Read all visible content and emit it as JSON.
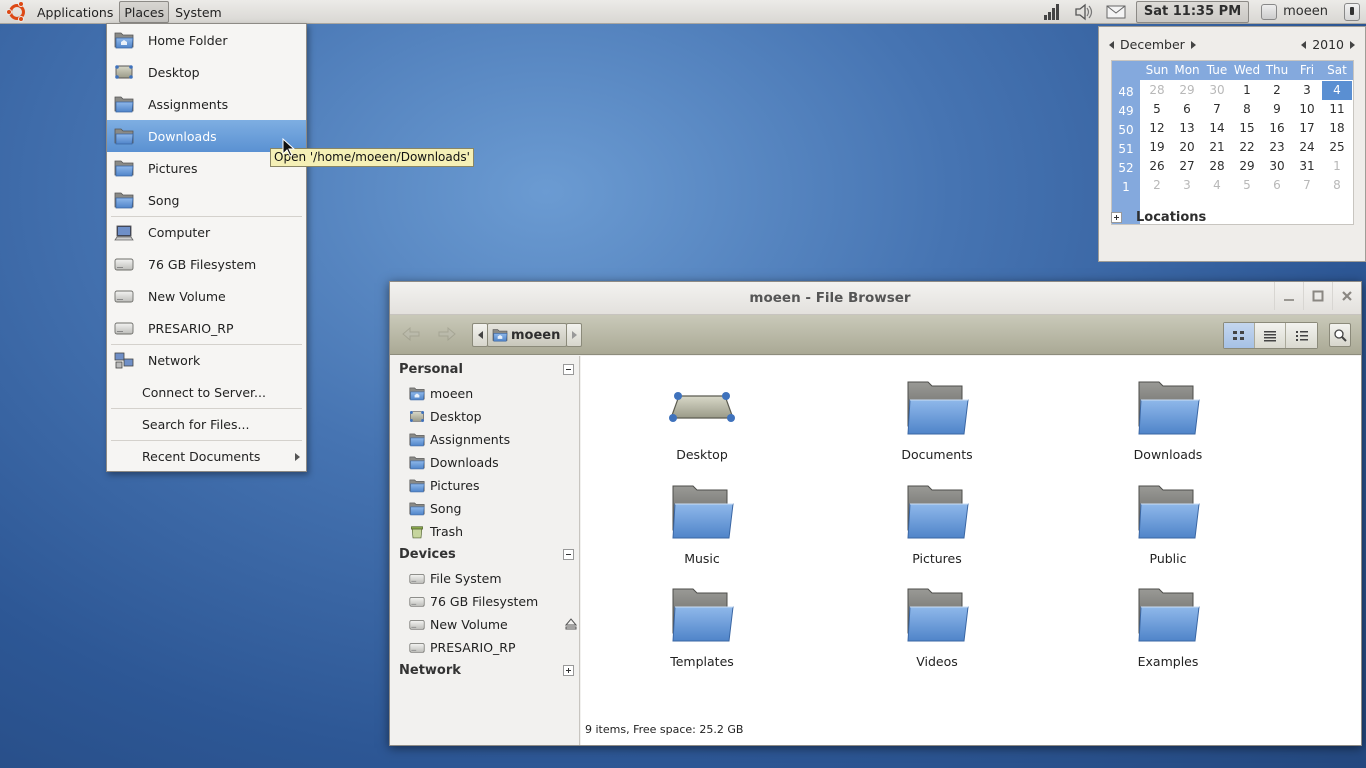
{
  "panel": {
    "menus": [
      "Applications",
      "Places",
      "System"
    ],
    "clock": "Sat 11:35 PM",
    "user": "moeen"
  },
  "places_menu": {
    "items": [
      {
        "label": "Home Folder",
        "icon": "home-folder-icon"
      },
      {
        "label": "Desktop",
        "icon": "desktop-icon"
      },
      {
        "label": "Assignments",
        "icon": "folder-icon"
      },
      {
        "label": "Downloads",
        "icon": "folder-icon",
        "highlighted": true
      },
      {
        "label": "Pictures",
        "icon": "folder-icon"
      },
      {
        "label": "Song",
        "icon": "folder-icon"
      },
      {
        "label": "Computer",
        "icon": "computer-icon"
      },
      {
        "label": "76 GB Filesystem",
        "icon": "drive-icon"
      },
      {
        "label": "New Volume",
        "icon": "drive-icon"
      },
      {
        "label": "PRESARIO_RP",
        "icon": "drive-icon"
      },
      {
        "label": "Network",
        "icon": "network-icon"
      },
      {
        "label": "Connect to Server..."
      },
      {
        "label": "Search for Files..."
      },
      {
        "label": "Recent Documents"
      }
    ]
  },
  "tooltip": "Open '/home/moeen/Downloads'",
  "calendar": {
    "month": "December",
    "year": "2010",
    "weekdays": [
      "Sun",
      "Mon",
      "Tue",
      "Wed",
      "Thu",
      "Fri",
      "Sat"
    ],
    "weeks": [
      "48",
      "49",
      "50",
      "51",
      "52",
      "1"
    ],
    "days": [
      [
        "28",
        "29",
        "30",
        "1",
        "2",
        "3",
        "4"
      ],
      [
        "5",
        "6",
        "7",
        "8",
        "9",
        "10",
        "11"
      ],
      [
        "12",
        "13",
        "14",
        "15",
        "16",
        "17",
        "18"
      ],
      [
        "19",
        "20",
        "21",
        "22",
        "23",
        "24",
        "25"
      ],
      [
        "26",
        "27",
        "28",
        "29",
        "30",
        "31",
        "1"
      ],
      [
        "2",
        "3",
        "4",
        "5",
        "6",
        "7",
        "8"
      ]
    ],
    "selected_day": "4",
    "locations_label": "Locations"
  },
  "file_browser": {
    "title": "moeen - File Browser",
    "path_crumb": "moeen",
    "sidebar": {
      "personal_label": "Personal",
      "personal_items": [
        {
          "label": "moeen",
          "icon": "home-folder-icon"
        },
        {
          "label": "Desktop",
          "icon": "desktop-icon"
        },
        {
          "label": "Assignments",
          "icon": "folder-icon"
        },
        {
          "label": "Downloads",
          "icon": "folder-icon"
        },
        {
          "label": "Pictures",
          "icon": "folder-icon"
        },
        {
          "label": "Song",
          "icon": "folder-icon"
        },
        {
          "label": "Trash",
          "icon": "trash-icon"
        }
      ],
      "devices_label": "Devices",
      "device_items": [
        {
          "label": "File System",
          "icon": "drive-icon"
        },
        {
          "label": "76 GB Filesystem",
          "icon": "drive-icon"
        },
        {
          "label": "New Volume",
          "icon": "drive-icon",
          "eject": true
        },
        {
          "label": "PRESARIO_RP",
          "icon": "drive-icon"
        }
      ],
      "network_label": "Network"
    },
    "items": [
      {
        "label": "Desktop",
        "icon": "desktop-icon"
      },
      {
        "label": "Documents",
        "icon": "folder-icon"
      },
      {
        "label": "Downloads",
        "icon": "folder-icon"
      },
      {
        "label": "Music",
        "icon": "folder-icon"
      },
      {
        "label": "Pictures",
        "icon": "folder-icon"
      },
      {
        "label": "Public",
        "icon": "folder-icon"
      },
      {
        "label": "Templates",
        "icon": "folder-icon"
      },
      {
        "label": "Videos",
        "icon": "folder-icon"
      },
      {
        "label": "Examples",
        "icon": "folder-icon"
      }
    ],
    "status": "9 items, Free space: 25.2 GB"
  },
  "colors": {
    "highlight": "#5a91d2",
    "folder_blue": "#6a9bd8",
    "calendar_header": "#84a9dd"
  }
}
